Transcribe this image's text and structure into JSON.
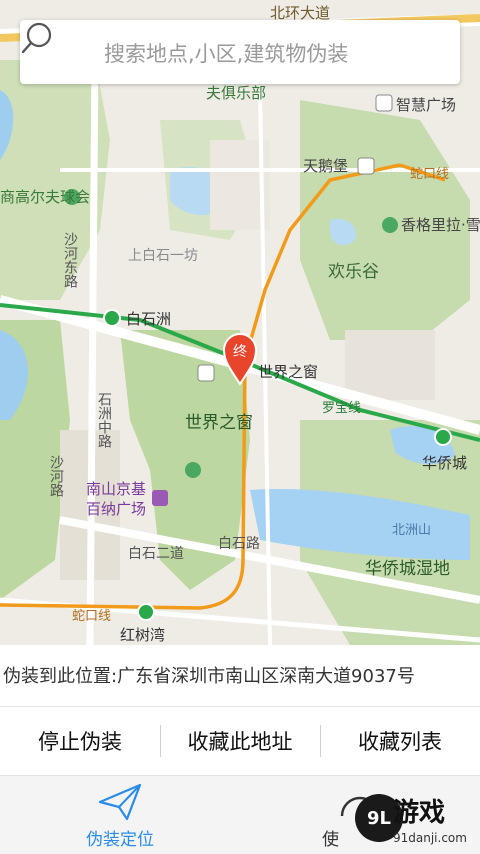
{
  "search": {
    "placeholder": "搜索地点,小区,建筑物伪装"
  },
  "map": {
    "marker_label": "终",
    "road_labels": {
      "north_ring": "北环大道",
      "shebou_line": "蛇口线",
      "luobao_line": "罗宝线",
      "baishi_road": "白石路",
      "baishi_road_2": "白石二道",
      "shahe_east": "沙河东路",
      "shahe": "沙河路",
      "shizhou_middle": "石洲中路",
      "shangbaishi": "上白石一坊",
      "beizhoushan": "北洲山"
    },
    "poi_labels": {
      "fujubu": "夫俱乐部",
      "zhihui": "智慧广场",
      "tiane": "天鹅堡",
      "shangaoer": "商高尔夫球会",
      "xiangelila": "香格里拉·雪",
      "huanlegu": "欢乐谷",
      "baishizhou": "白石洲",
      "shijiezhichuang_station": "世界之窗",
      "shijiezhichuang": "世界之窗",
      "huaqiaocheng": "华侨城",
      "nanshan_jingji_1": "南山京基",
      "nanshan_jingji_2": "百纳广场",
      "huaqiaocheng_shidi": "华侨城湿地",
      "hongshuwan": "红树湾",
      "sheko_line_lower": "蛇口线"
    }
  },
  "address": {
    "text": "伪装到此位置:广东省深圳市南山区深南大道9037号"
  },
  "actions": {
    "stop_label": "停止伪装",
    "save_label": "收藏此地址",
    "list_label": "收藏列表"
  },
  "tabs": {
    "disguise_label": "伪装定位",
    "other_label": "使"
  },
  "watermark": {
    "badge": "9L",
    "title": "游戏",
    "sub": "91danji.com"
  },
  "colors": {
    "accent": "#2a8ce6",
    "metro_green": "#2aa84a",
    "metro_orange": "#f29b1a",
    "marker_red": "#e8452c"
  }
}
